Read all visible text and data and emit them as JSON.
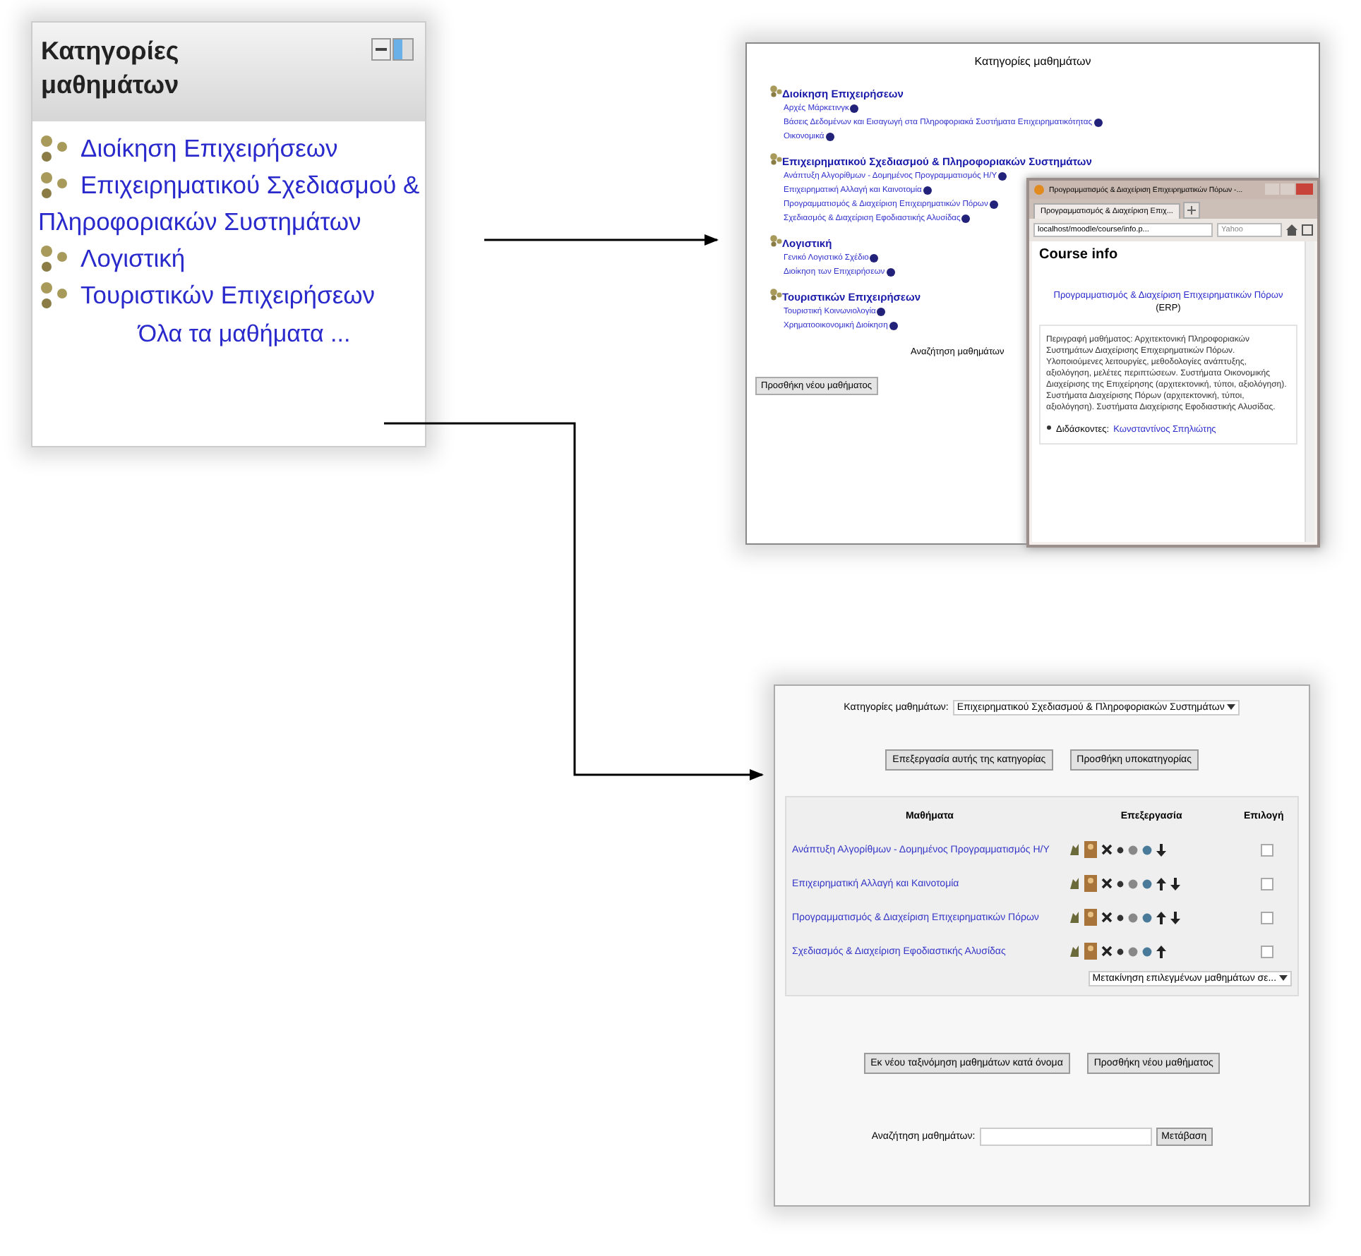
{
  "category_block": {
    "title": "Κατηγορίες μαθημάτων",
    "categories": [
      {
        "name": "Διοίκηση Επιχειρήσεων"
      },
      {
        "name": "Επιχειρηματικού Σχεδιασμού & Πληροφοριακών Συστημάτων"
      },
      {
        "name": "Λογιστική"
      },
      {
        "name": "Τουριστικών Επιχειρήσεων"
      }
    ],
    "all_courses_link": "Όλα τα μαθήματα ..."
  },
  "category_page": {
    "title": "Κατηγορίες μαθημάτων",
    "categories": [
      {
        "name": "Διοίκηση Επιχειρήσεων",
        "courses": [
          "Αρχές Μάρκετινγκ",
          "Βάσεις Δεδομένων και Εισαγωγή στα Πληροφοριακά Συστήματα Επιχειρηματικότητας",
          "Οικονομικά"
        ]
      },
      {
        "name": "Επιχειρηματικού Σχεδιασμού & Πληροφοριακών Συστημάτων",
        "courses": [
          "Ανάπτυξη Αλγορίθμων - Δομημένος Προγραμματισμός Η/Υ",
          "Επιχειρηματική Αλλαγή και Καινοτομία",
          "Προγραμματισμός & Διαχείριση Επιχειρηματικών Πόρων",
          "Σχεδιασμός & Διαχείριση Εφοδιαστικής Αλυσίδας"
        ]
      },
      {
        "name": "Λογιστική",
        "courses": [
          "Γενικό Λογιστικό Σχέδιο",
          "Διοίκηση των Επιχειρήσεων"
        ]
      },
      {
        "name": "Τουριστικών Επιχειρήσεων",
        "courses": [
          "Τουριστική Κοινωνιολογία",
          "Χρηματοοικονομική Διοίκηση"
        ]
      }
    ],
    "search_label": "Αναζήτηση μαθημάτων",
    "add_button": "Προσθήκη νέου μαθήματος",
    "popup": {
      "window_title": "Προγραμματισμός & Διαχείριση Επιχειρηματικών Πόρων -...",
      "tab": "Προγραμματισμός & Διαχείριση Επιχ...",
      "url": "localhost/moodle/course/info.p...",
      "search_placeholder": "Yahoo",
      "heading": "Course info",
      "course_link": "Προγραμματισμός & Διαχείριση Επιχειρηματικών Πόρων",
      "course_code": "(ERP)",
      "description": "Περιγραφή μαθήματος: Αρχιτεκτονική Πληροφοριακών Συστημάτων Διαχείρισης Επιχειρηματικών Πόρων. Υλοποιούμενες λειτουργίες, μεθοδολογίες ανάπτυξης, αξιολόγηση, μελέτες περιπτώσεων. Συστήματα Οικονομικής Διαχείρισης της Επιχείρησης (αρχιτεκτονική, τύποι, αξιολόγηση). Συστήματα Διαχείρισης Πόρων (αρχιτεκτονική, τύποι, αξιολόγηση). Συστήματα Διαχείρισης Εφοδιαστικής Αλυσίδας.",
      "teacher_label": "Διδάσκοντες:",
      "teacher": "Κωνσταντίνος Σπηλιώτης"
    }
  },
  "category_edit_page": {
    "category_label": "Κατηγορίες μαθημάτων:",
    "category_value": "Επιχειρηματικού Σχεδιασμού & Πληροφοριακών Συστημάτων",
    "buttons": [
      "Επεξεργασία αυτής της κατηγορίας",
      "Προσθήκη υποκατηγορίας"
    ],
    "columns": [
      "Μαθήματα",
      "Επεξεργασία",
      "Επιλογή"
    ],
    "rows": [
      {
        "name": "Ανάπτυξη Αλγορίθμων - Δομημένος Προγραμματισμός Η/Υ",
        "up": false,
        "down": true,
        "checked": false
      },
      {
        "name": "Επιχειρηματική Αλλαγή και Καινοτομία",
        "up": true,
        "down": true,
        "checked": false
      },
      {
        "name": "Προγραμματισμός & Διαχείριση Επιχειρηματικών Πόρων",
        "up": true,
        "down": true,
        "checked": false
      },
      {
        "name": "Σχεδιασμός & Διαχείριση Εφοδιαστικής Αλυσίδας",
        "up": true,
        "down": false,
        "checked": false
      }
    ],
    "move_select": "Μετακίνηση επιλεγμένων μαθημάτων σε...",
    "bottom_buttons": [
      "Εκ νέου ταξινόμηση μαθημάτων κατά όνομα",
      "Προσθήκη νέου μαθήματος"
    ],
    "search_label": "Αναζήτηση μαθημάτων:",
    "search_button": "Μετάβαση"
  }
}
